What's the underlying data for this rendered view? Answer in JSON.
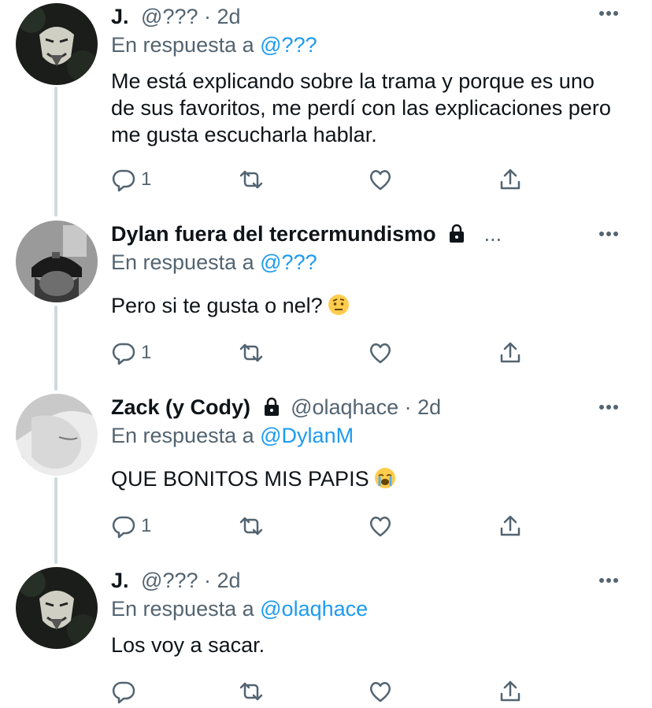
{
  "tweets": [
    {
      "name": "J.",
      "handle": "@???",
      "time": "2d",
      "reply_label": "En respuesta a",
      "reply_to": "@???",
      "text": "Me está explicando sobre la trama y porque es uno de sus favoritos, me perdí con las explicaciones pero me gusta escucharla hablar.",
      "reply_count": "1",
      "avatar": "anonymous-mask"
    },
    {
      "name": "Dylan fuera del tercermundismo",
      "locked": true,
      "truncated": "...",
      "reply_label": "En respuesta a",
      "reply_to": "@???",
      "text": "Pero si te gusta o nel?",
      "emoji": "raised-eyebrow-face",
      "reply_count": "1",
      "avatar": "person-beanie"
    },
    {
      "name": "Zack (y Cody)",
      "locked": true,
      "handle": "@olaqhace",
      "time": "2d",
      "reply_label": "En respuesta a",
      "reply_to": "@DylanM",
      "text": "QUE BONITOS MIS PAPIS",
      "emoji": "loudly-crying-face",
      "reply_count": "1",
      "avatar": "face-profile-bw"
    },
    {
      "name": "J.",
      "handle": "@???",
      "time": "2d",
      "reply_label": "En respuesta a",
      "reply_to": "@olaqhace",
      "text": "Los voy a sacar.",
      "reply_count": "",
      "avatar": "anonymous-mask"
    }
  ],
  "separator": "·",
  "icons": {
    "reply": "reply-icon",
    "retweet": "retweet-icon",
    "like": "heart-icon",
    "share": "share-icon",
    "more": "more-icon",
    "lock": "lock-icon"
  },
  "colors": {
    "text": "#0f1419",
    "secondary": "#536471",
    "accent": "#1d9bf0",
    "thread_line": "#cfd9de"
  }
}
